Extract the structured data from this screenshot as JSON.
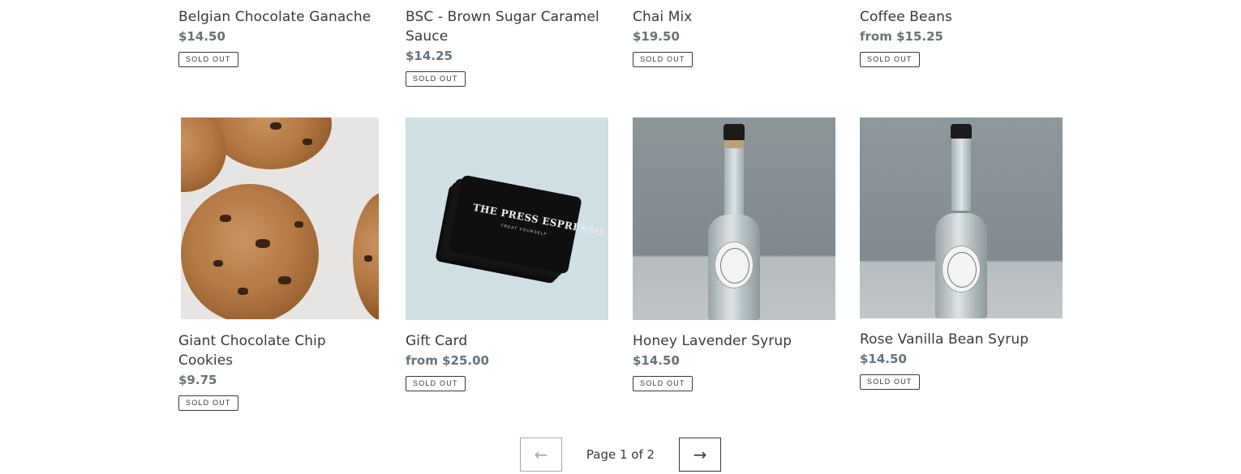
{
  "products_row1": [
    {
      "title": "Belgian Chocolate Ganache",
      "price": "$14.50",
      "badge": "Sold out"
    },
    {
      "title": "BSC - Brown Sugar Caramel Sauce",
      "price": "$14.25",
      "badge": "Sold out"
    },
    {
      "title": "Chai Mix",
      "price": "$19.50",
      "badge": "Sold out"
    },
    {
      "title": "Coffee Beans",
      "price": "from $15.25",
      "badge": "Sold out"
    }
  ],
  "products_row2": [
    {
      "title": "Giant Chocolate Chip Cookies",
      "price": "$9.75",
      "badge": "Sold out",
      "image": "cookies-photo"
    },
    {
      "title": "Gift Card",
      "price": "from $25.00",
      "badge": "Sold out",
      "image": "gift-card-photo"
    },
    {
      "title": "Honey Lavender Syrup",
      "price": "$14.50",
      "badge": "Sold out",
      "image": "syrup-bottle-photo"
    },
    {
      "title": "Rose Vanilla Bean Syrup",
      "price": "$14.50",
      "badge": "Sold out",
      "image": "syrup-bottle-photo"
    }
  ],
  "gift_card_image": {
    "brand": "THE PRESS ESPRESSO",
    "tagline": "TREAT YOURSELF"
  },
  "pagination": {
    "prev_icon": "←",
    "next_icon": "→",
    "label": "Page 1 of 2"
  }
}
